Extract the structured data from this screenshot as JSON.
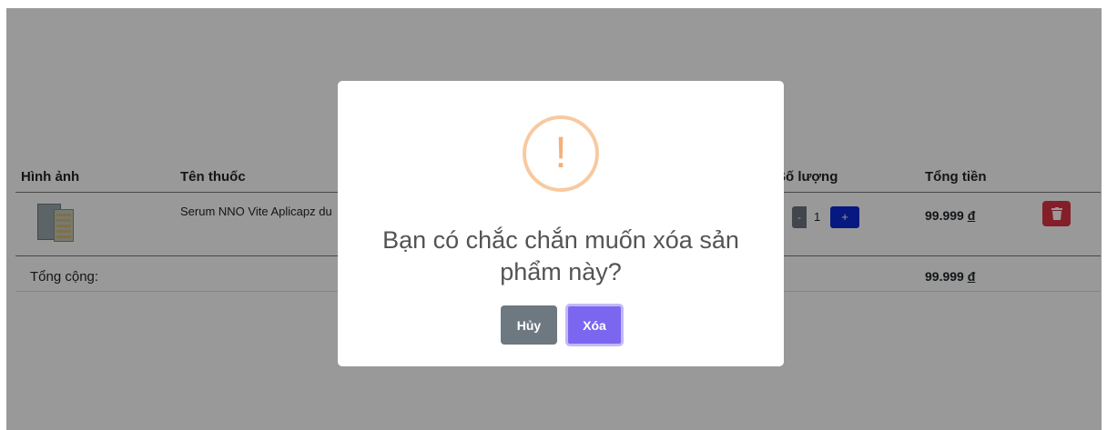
{
  "table": {
    "headers": {
      "image": "Hình ảnh",
      "name": "Tên thuốc",
      "quantity": "Số lượng",
      "total": "Tổng tiền"
    },
    "rows": [
      {
        "name": "Serum NNO Vite Aplicapz du",
        "quantity": "1",
        "total": "99.999",
        "currency": "đ",
        "minus": "-",
        "plus": "+"
      }
    ],
    "total_label": "Tổng cộng:",
    "grand_total": "99.999",
    "currency": "đ"
  },
  "modal": {
    "icon": "warning-exclamation-icon",
    "icon_glyph": "!",
    "title": "Bạn có chắc chắn muốn xóa sản phẩm này?",
    "cancel_label": "Hủy",
    "confirm_label": "Xóa"
  },
  "colors": {
    "overlay": "rgba(0,0,0,0.4)",
    "confirm": "#7b66f0",
    "cancel": "#6e7881",
    "warning": "#f8c9a0",
    "delete": "#dc3545",
    "plus": "#0d2bd6"
  }
}
